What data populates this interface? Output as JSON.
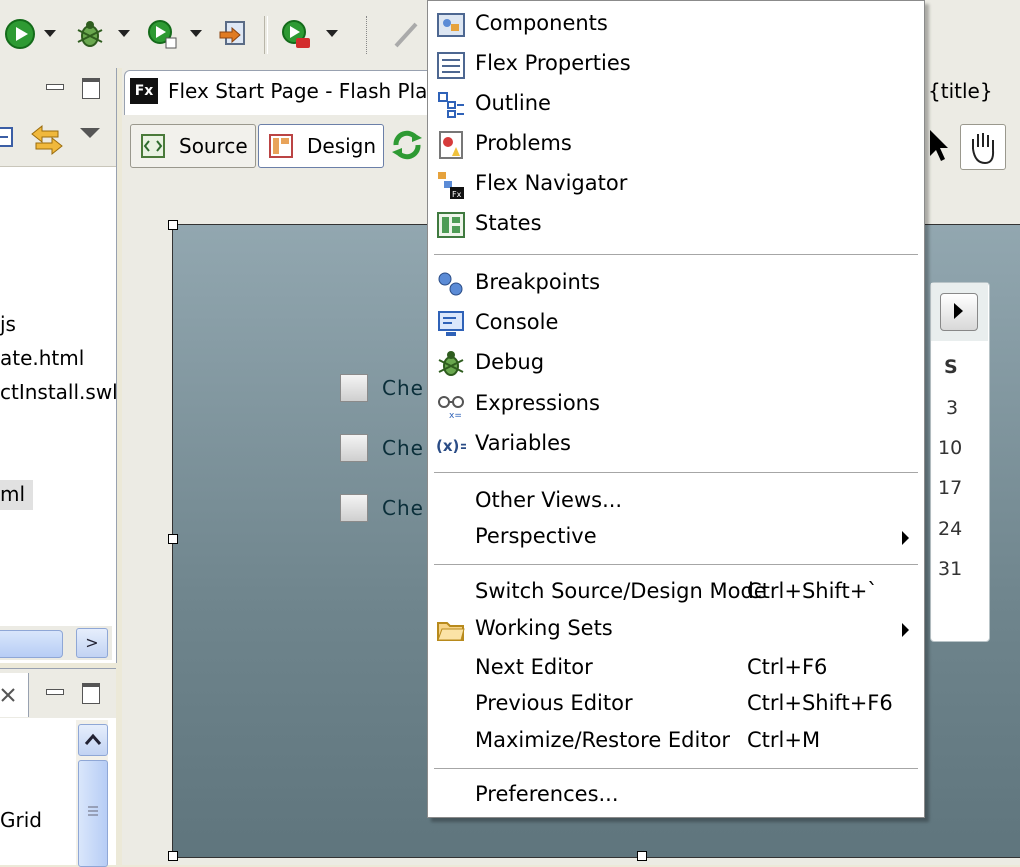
{
  "editor": {
    "tab_title": "Flex Start Page - Flash Pla",
    "title_fragment": "{title}",
    "source_label": "Source",
    "design_label": "Design",
    "checkbox_labels": [
      "Che",
      "Che",
      "Che"
    ]
  },
  "left_pane": {
    "files": [
      "js",
      "ate.html",
      "ctInstall.swl",
      "ml"
    ],
    "bottom_item": "Grid"
  },
  "date_chooser": {
    "header": "S",
    "days": [
      "3",
      "10",
      "17",
      "24",
      "31"
    ]
  },
  "menu": {
    "group1": [
      {
        "label": "Components",
        "icon": "components-icon"
      },
      {
        "label": "Flex Properties",
        "icon": "flex-properties-icon"
      },
      {
        "label": "Outline",
        "icon": "outline-icon"
      },
      {
        "label": "Problems",
        "icon": "problems-icon"
      },
      {
        "label": "Flex Navigator",
        "icon": "flex-navigator-icon"
      },
      {
        "label": "States",
        "icon": "states-icon"
      }
    ],
    "group2": [
      {
        "label": "Breakpoints",
        "icon": "breakpoints-icon"
      },
      {
        "label": "Console",
        "icon": "console-icon"
      },
      {
        "label": "Debug",
        "icon": "debug-bug-icon"
      },
      {
        "label": "Expressions",
        "icon": "expressions-icon"
      },
      {
        "label": "Variables",
        "icon": "variables-icon"
      }
    ],
    "other_views": "Other Views...",
    "perspective": "Perspective",
    "switch_mode": {
      "label": "Switch Source/Design Mode",
      "shortcut": "Ctrl+Shift+`"
    },
    "working_sets": "Working Sets",
    "next_editor": {
      "label": "Next Editor",
      "shortcut": "Ctrl+F6"
    },
    "previous_editor": {
      "label": "Previous Editor",
      "shortcut": "Ctrl+Shift+F6"
    },
    "maximize_editor": {
      "label": "Maximize/Restore Editor",
      "shortcut": "Ctrl+M"
    },
    "preferences": "Preferences..."
  },
  "colors": {
    "menu_bg": "#ffffff",
    "canvas_top": "#92a7b0",
    "canvas_bottom": "#5f757d",
    "chrome": "#ecebe4"
  }
}
